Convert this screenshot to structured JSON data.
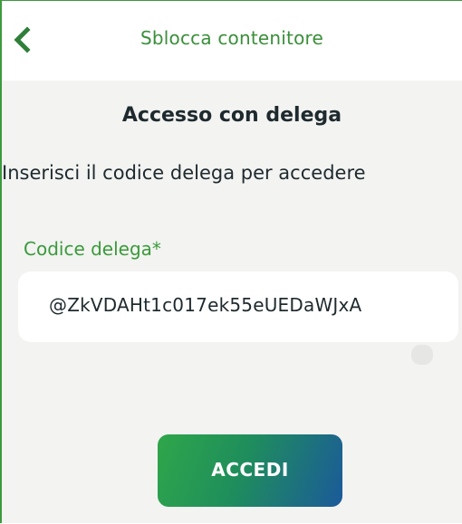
{
  "header": {
    "title": "Sblocca contenitore",
    "back_icon": "chevron-left-icon"
  },
  "main": {
    "section_title": "Accesso con delega",
    "instructions": "Inserisci il codice delega per accedere",
    "field": {
      "label": "Codice delega*",
      "value": "@ZkVDAHt1c017ek55eUEDaWJxA"
    },
    "submit_label": "ACCEDI"
  },
  "colors": {
    "accent_green": "#3a8f3a",
    "button_gradient_start": "#2fa64a",
    "button_gradient_end": "#1b5a9a",
    "background": "#f3f3f2",
    "text_dark": "#1e2a2e"
  }
}
